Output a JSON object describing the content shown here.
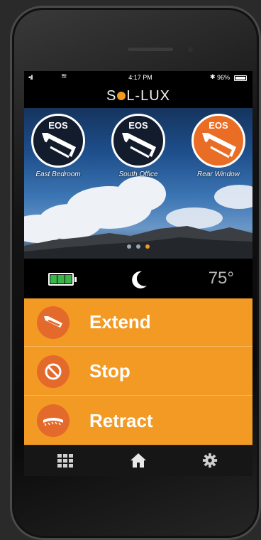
{
  "status_bar": {
    "signal": "•ıll",
    "wifi": "≋",
    "time": "4:17 PM",
    "bluetooth": "✱",
    "battery_percent": "96%"
  },
  "header": {
    "logo_left": "S",
    "logo_right": "L-LUX"
  },
  "locations": [
    {
      "badge": "EOS",
      "name": "East Bedroom",
      "active": false
    },
    {
      "badge": "EOS",
      "name": "South Office",
      "active": false
    },
    {
      "badge": "EOS",
      "name": "Rear Window",
      "active": true
    }
  ],
  "page_indicator": {
    "count": 3,
    "active_index": 2
  },
  "info": {
    "battery_level": 1.0,
    "weather_icon": "moon-icon",
    "temperature": "75°"
  },
  "controls": [
    {
      "label": "Extend",
      "icon": "extend-awning-icon"
    },
    {
      "label": "Stop",
      "icon": "stop-icon"
    },
    {
      "label": "Retract",
      "icon": "retract-awning-icon"
    }
  ],
  "tabs": [
    {
      "icon": "grid-icon"
    },
    {
      "icon": "home-icon"
    },
    {
      "icon": "gear-icon"
    }
  ],
  "colors": {
    "accent_orange": "#f29a24",
    "icon_orange": "#e46a2b",
    "active_location": "#e96d24",
    "battery_green": "#3bb54a"
  }
}
